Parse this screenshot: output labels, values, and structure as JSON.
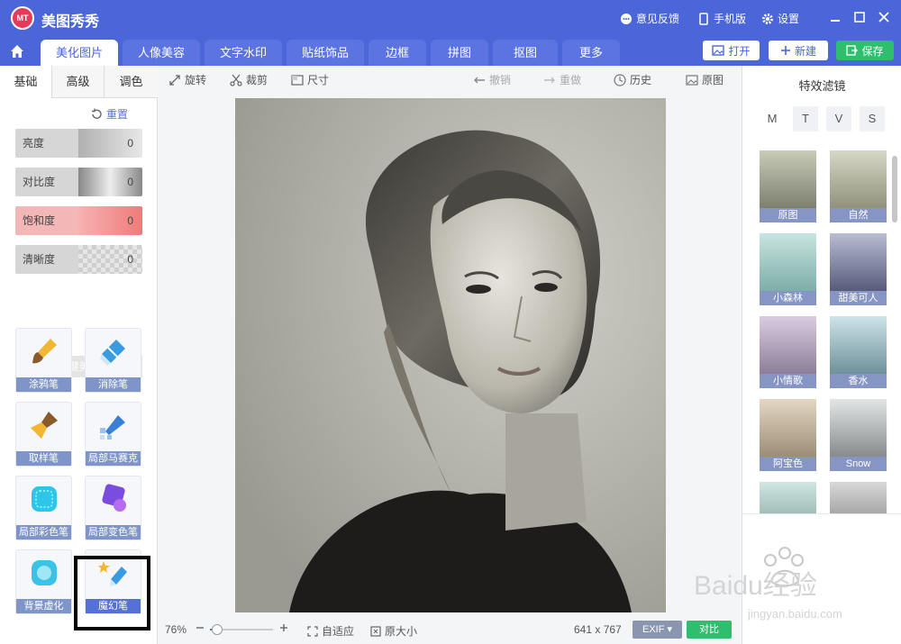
{
  "app": {
    "title": "美图秀秀",
    "logo_text": "MT"
  },
  "titlebar": {
    "feedback": "意见反馈",
    "mobile": "手机版",
    "settings": "设置"
  },
  "tabs": [
    "美化图片",
    "人像美容",
    "文字水印",
    "贴纸饰品",
    "边框",
    "拼图",
    "抠图",
    "更多"
  ],
  "actions": {
    "open": "打开",
    "new": "新建",
    "save": "保存"
  },
  "left": {
    "subtabs": [
      "基础",
      "高级",
      "调色"
    ],
    "reset": "重置",
    "sliders": [
      {
        "label": "亮度",
        "value": "0",
        "color": "#b9b9b9"
      },
      {
        "label": "对比度",
        "value": "0",
        "color": "#9a9a9a"
      },
      {
        "label": "饱和度",
        "value": "0",
        "color": "#f08a8a"
      },
      {
        "label": "清晰度",
        "value": "0",
        "color": "#c9c9c9"
      }
    ],
    "one_key": "一键美化",
    "tools": [
      "涂鸦笔",
      "消除笔",
      "取样笔",
      "局部马赛克",
      "局部彩色笔",
      "局部变色笔",
      "背景虚化",
      "魔幻笔"
    ]
  },
  "toolbar": {
    "rotate": "旋转",
    "crop": "裁剪",
    "size": "尺寸",
    "undo": "撤销",
    "redo": "重做",
    "history": "历史",
    "original": "原图"
  },
  "bottom": {
    "zoom": "76%",
    "fit": "自适应",
    "actual": "原大小",
    "dimensions": "641 x 767",
    "exif": "EXIF",
    "compare": "对比",
    "zoom_level": 0.12
  },
  "right": {
    "title": "特效滤镜",
    "tabs": [
      "M",
      "T",
      "V",
      "S"
    ],
    "filters": [
      "原图",
      "自然",
      "小森林",
      "甜美可人",
      "小情歌",
      "香水",
      "阿宝色",
      "Snow"
    ]
  },
  "watermark": {
    "brand": "Baidu经验",
    "url": "jingyan.baidu.com"
  }
}
